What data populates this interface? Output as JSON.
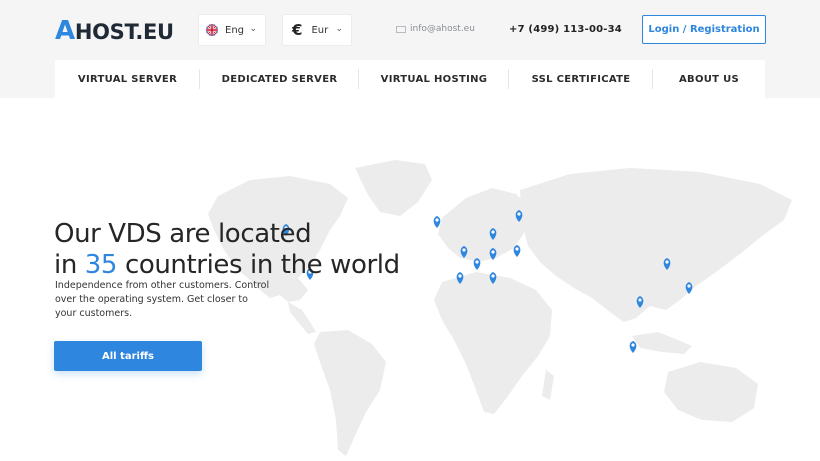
{
  "brand": {
    "logo_letter": "A",
    "logo_rest": "HOST.EU",
    "accent": "#2e86de"
  },
  "header": {
    "language": {
      "selected": "Eng",
      "flag": "uk-flag-icon"
    },
    "currency": {
      "symbol": "€",
      "selected": "Eur"
    },
    "email": "info@ahost.eu",
    "phone": "+7 (499) 113-00-34",
    "login_label": "Login / Registration"
  },
  "nav": {
    "items": [
      {
        "label": "VIRTUAL SERVER"
      },
      {
        "label": "DEDICATED SERVER"
      },
      {
        "label": "VIRTUAL HOSTING"
      },
      {
        "label": "SSL CERTIFICATE"
      },
      {
        "label": "ABOUT US"
      }
    ]
  },
  "hero": {
    "title_line1": "Our VDS are located",
    "title_in": "in",
    "title_number": "35",
    "title_rest": "countries in the world",
    "subtitle": "Independence from other customers. Control over the operating system. Get closer to your customers.",
    "cta_label": "All tariffs"
  },
  "map": {
    "pin_color": "#2e86de",
    "land_color": "#ececec"
  }
}
